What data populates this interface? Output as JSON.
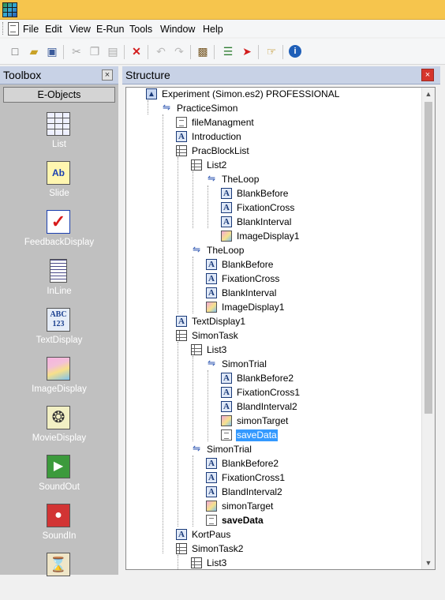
{
  "menu": {
    "items": [
      "File",
      "Edit",
      "View",
      "E-Run",
      "Tools",
      "Window",
      "Help"
    ]
  },
  "toolbar": {
    "buttons": [
      "new-icon",
      "open-icon",
      "save-icon",
      "cut-icon",
      "copy-icon",
      "paste-icon",
      "delete-icon",
      "undo-icon",
      "redo-icon",
      "properties-icon",
      "script-icon",
      "run-icon",
      "test-icon",
      "info-icon"
    ]
  },
  "toolbox": {
    "title": "Toolbox",
    "tab": "E-Objects",
    "tools": [
      "List",
      "Slide",
      "FeedbackDisplay",
      "InLine",
      "TextDisplay",
      "ImageDisplay",
      "MovieDisplay",
      "SoundOut",
      "SoundIn"
    ]
  },
  "structure": {
    "title": "Structure",
    "nodes": [
      {
        "label": "Experiment (Simon.es2) PROFESSIONAL",
        "icon": "experiment-icon"
      },
      {
        "label": "PracticeSimon",
        "icon": "procedure-icon"
      },
      {
        "label": "fileManagment",
        "icon": "inline-icon"
      },
      {
        "label": "Introduction",
        "icon": "text-display-icon"
      },
      {
        "label": "PracBlockList",
        "icon": "list-icon"
      },
      {
        "label": "List2",
        "icon": "list-icon"
      },
      {
        "label": "TheLoop",
        "icon": "procedure-icon"
      },
      {
        "label": "BlankBefore",
        "icon": "text-display-icon"
      },
      {
        "label": "FixationCross",
        "icon": "text-display-icon"
      },
      {
        "label": "BlankInterval",
        "icon": "text-display-icon"
      },
      {
        "label": "ImageDisplay1",
        "icon": "image-display-icon"
      },
      {
        "label": "TheLoop",
        "icon": "procedure-icon"
      },
      {
        "label": "BlankBefore",
        "icon": "text-display-icon"
      },
      {
        "label": "FixationCross",
        "icon": "text-display-icon"
      },
      {
        "label": "BlankInterval",
        "icon": "text-display-icon"
      },
      {
        "label": "ImageDisplay1",
        "icon": "image-display-icon"
      },
      {
        "label": "TextDisplay1",
        "icon": "text-display-icon"
      },
      {
        "label": "SimonTask",
        "icon": "list-icon"
      },
      {
        "label": "List3",
        "icon": "list-icon"
      },
      {
        "label": "SimonTrial",
        "icon": "procedure-icon"
      },
      {
        "label": "BlankBefore2",
        "icon": "text-display-icon"
      },
      {
        "label": "FixationCross1",
        "icon": "text-display-icon"
      },
      {
        "label": "BlandInterval2",
        "icon": "text-display-icon"
      },
      {
        "label": "simonTarget",
        "icon": "image-display-icon"
      },
      {
        "label": "saveData",
        "icon": "inline-icon"
      },
      {
        "label": "SimonTrial",
        "icon": "procedure-icon"
      },
      {
        "label": "BlankBefore2",
        "icon": "text-display-icon"
      },
      {
        "label": "FixationCross1",
        "icon": "text-display-icon"
      },
      {
        "label": "BlandInterval2",
        "icon": "text-display-icon"
      },
      {
        "label": "simonTarget",
        "icon": "image-display-icon"
      },
      {
        "label": "saveData",
        "icon": "inline-icon"
      },
      {
        "label": "KortPaus",
        "icon": "text-display-icon"
      },
      {
        "label": "SimonTask2",
        "icon": "list-icon"
      },
      {
        "label": "List3",
        "icon": "list-icon"
      }
    ]
  }
}
